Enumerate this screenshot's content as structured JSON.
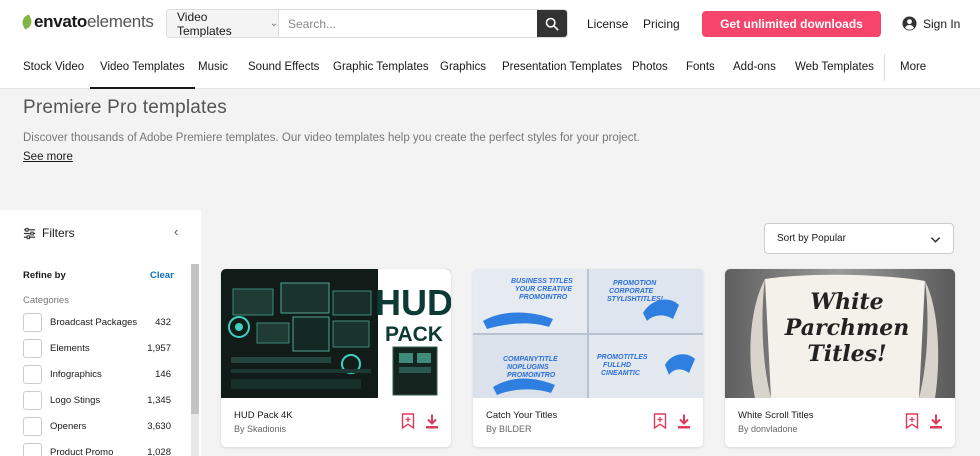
{
  "brand": {
    "logo_bold": "envato",
    "logo_light": "elements"
  },
  "search": {
    "category": "Video Templates",
    "placeholder": "Search..."
  },
  "top_links": {
    "license": "License",
    "pricing": "Pricing"
  },
  "cta_label": "Get unlimited downloads",
  "signin_label": "Sign In",
  "nav": {
    "items": [
      "Stock Video",
      "Video Templates",
      "Music",
      "Sound Effects",
      "Graphic Templates",
      "Graphics",
      "Presentation Templates",
      "Photos",
      "Fonts",
      "Add-ons",
      "Web Templates"
    ],
    "active_index": 1,
    "more": "More"
  },
  "hero": {
    "title": "Premiere Pro templates",
    "description": "Discover thousands of Adobe Premiere templates. Our video templates help you create the perfect styles for your project.",
    "see_more": "See more"
  },
  "filters": {
    "heading": "Filters",
    "refine_by": "Refine by",
    "clear": "Clear",
    "categories_label": "Categories",
    "categories": [
      {
        "name": "Broadcast Packages",
        "count": "432"
      },
      {
        "name": "Elements",
        "count": "1,957"
      },
      {
        "name": "Infographics",
        "count": "146"
      },
      {
        "name": "Logo Stings",
        "count": "1,345"
      },
      {
        "name": "Openers",
        "count": "3,630"
      },
      {
        "name": "Product Promo",
        "count": "1,028"
      }
    ]
  },
  "sort": {
    "label": "Sort by Popular"
  },
  "cards": [
    {
      "title": "HUD Pack 4K",
      "author": "By Skadionis",
      "thumb_text": [
        "HUD",
        "PACK"
      ]
    },
    {
      "title": "Catch Your Titles",
      "author": "By BILDER",
      "thumb_text": [
        "BUSINESS TITLES",
        "YOUR CREATIVE",
        "PROMOINTRO",
        "PROMOTION",
        "CORPORATE",
        "STYLISHTITLES!",
        "COMPANYTITLE",
        "NOPLUGINS",
        "PROMOINTRO",
        "PROMOTITLES",
        "FULLHD",
        "CINEAMTIC"
      ]
    },
    {
      "title": "White Scroll Titles",
      "author": "By donvladone",
      "thumb_text": [
        "White",
        "Parchmen",
        "Titles!"
      ]
    }
  ],
  "colors": {
    "accent": "#f5456a",
    "brand_green": "#82b541",
    "link_blue": "#0e6fbd",
    "icon_red": "#e03a5a"
  }
}
